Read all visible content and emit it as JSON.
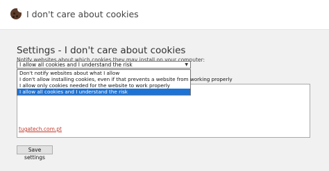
{
  "window": {
    "title": "I don't care about cookies",
    "logo_icon": "cookie-icon"
  },
  "settings": {
    "heading": "Settings - I don't care about cookies",
    "helper_text": "Notify websites about which cookies they may install on your computer:",
    "select": {
      "selected_value": "I allow all cookies and I understand the risk",
      "options": [
        {
          "label": "Don't notify websites about what I allow",
          "selected": false
        },
        {
          "label": "I don't allow installing cookies, even if that prevents a website from working properly",
          "selected": false
        },
        {
          "label": "I allow only cookies needed for the website to work properly",
          "selected": false
        },
        {
          "label": "I allow all cookies and I understand the risk",
          "selected": true
        }
      ]
    },
    "textarea_value": "",
    "link_text": "tugatech.com.pt",
    "save_label": "Save settings"
  },
  "colors": {
    "selection": "#1e73d6",
    "link": "#c0392b"
  }
}
